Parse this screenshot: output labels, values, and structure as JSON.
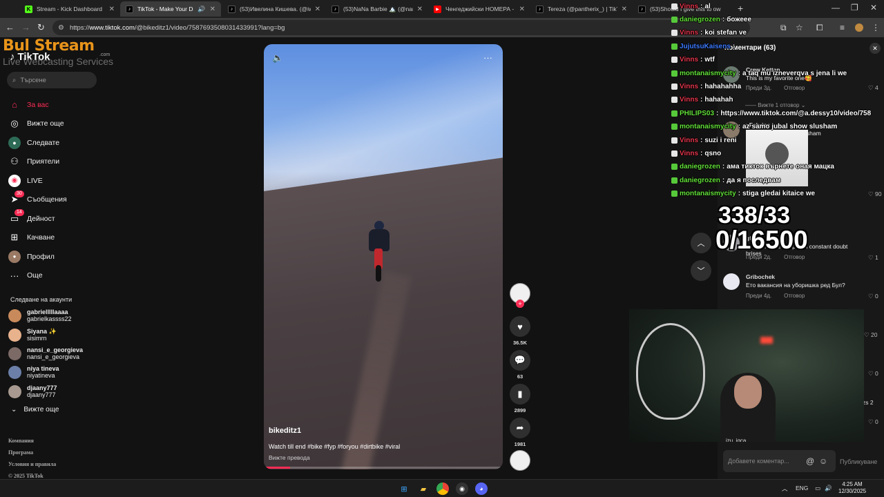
{
  "tabs": [
    {
      "title": "Stream - Kick Dashboard",
      "icon": "kick"
    },
    {
      "title": "TikTok - Make Your Day",
      "icon": "tiktok",
      "active": true
    },
    {
      "title": "(53)Ивелина Кишева. (@iwkaf",
      "icon": "tiktok"
    },
    {
      "title": "(53)NaNa Barbie 🏔️ (@nanaba",
      "icon": "tiktok"
    },
    {
      "title": "Ченгеджийски НОМЕРА - You",
      "icon": "youtube"
    },
    {
      "title": "Tereza (@pantherix_) | TikTok",
      "icon": "tiktok"
    },
    {
      "title": "(53)Should I give this to ow",
      "icon": "tiktok"
    }
  ],
  "address": {
    "scheme": "https://",
    "host": "www.tiktok.com",
    "path": "/@bikeditz1/video/7587693508031433991?lang=bg"
  },
  "tiktok": {
    "brand": "TikTok",
    "search_placeholder": "Търсене",
    "menu": [
      {
        "label": "За вас",
        "icon": "home-icon",
        "active": true
      },
      {
        "label": "Вижте още",
        "icon": "compass-icon"
      },
      {
        "label": "Следвате",
        "icon": "following-icon"
      },
      {
        "label": "Приятели",
        "icon": "friends-icon"
      },
      {
        "label": "LIVE",
        "icon": "live-icon"
      },
      {
        "label": "Съобщения",
        "icon": "messages-icon",
        "badge": "30"
      },
      {
        "label": "Дейност",
        "icon": "activity-icon",
        "badge": "14"
      },
      {
        "label": "Качване",
        "icon": "upload-icon"
      },
      {
        "label": "Профил",
        "icon": "profile-icon"
      },
      {
        "label": "Още",
        "icon": "more-icon"
      }
    ],
    "following_heading": "Следване на акаунти",
    "accounts": [
      {
        "name": "gabrielllllaaaa",
        "handle": "gabrielkassss22",
        "color": "#c98a5b"
      },
      {
        "name": "Siyana ✨",
        "handle": "sisimrn",
        "color": "#e8b28d"
      },
      {
        "name": "nansi_e_georgieva",
        "handle": "nansi_e_georgieva",
        "color": "#7c6a66"
      },
      {
        "name": "niya tineva",
        "handle": "niyatineva",
        "color": "#6b7fa8"
      },
      {
        "name": "djaany777",
        "handle": "djaany777",
        "color": "#a89a90"
      }
    ],
    "see_more": "Вижте още",
    "footer": [
      "Компания",
      "Програма",
      "Условия и правила",
      "© 2025 TikTok"
    ]
  },
  "video": {
    "author": "bikeditz1",
    "description": "Watch till end #bike #fyp #foryou #dirtbike #viral",
    "translate": "Вижте превода",
    "progress": 0.11,
    "likes": "36.5K",
    "comments": "63",
    "saves": "2899",
    "shares": "1981"
  },
  "comments_panel": {
    "heading": "Коментари (63)",
    "items": [
      {
        "name": "Crew Ketten",
        "text": "This is my favorite one🥰",
        "time": "Преди 3д.",
        "reply": "Отговор",
        "likes": "4",
        "color": "#6b7a70"
      },
      {
        "name": "xFabriss",
        "text": "az samo jubal show slusham",
        "time": "",
        "reply": "",
        "likes": "90",
        "color": "#8a7a6a"
      },
      {
        "name": "gf",
        "text": "every time i end up with constant doubt brises",
        "time": "Преди 2д.",
        "reply": "Отговор",
        "likes": "1",
        "color": "#9a9aa0"
      },
      {
        "name": "Gribochek",
        "text": "Ето вакансия на уборишка ред Бул?",
        "time": "Преди 4д.",
        "reply": "Отговор",
        "likes": "0",
        "color": "#e9e9f2"
      }
    ],
    "view_replies": "Вижте 1 отговор",
    "side_likes": [
      "20",
      "0",
      "0"
    ],
    "side_name": "zs 2",
    "bottom_name": "izu_iqca",
    "input_placeholder": "Добавете коментар...",
    "publish": "Публикуване"
  },
  "overlay": {
    "brand_line1": "Bul Stream",
    "brand_line2": "Live Webcasting Services",
    "brand_tld": ".com",
    "counter_line1": "338/33",
    "counter_line2": "0/16500"
  },
  "chat": [
    {
      "user": "Vinns",
      "color": "#e6394f",
      "msg": "al"
    },
    {
      "user": "daniegrozen",
      "color": "#63e03a",
      "msg": "божеее"
    },
    {
      "user": "Vinns",
      "color": "#e6394f",
      "msg": "koi stefan ve"
    },
    {
      "user": "JujutsuKaisens",
      "color": "#3e7bff",
      "msg": ""
    },
    {
      "user": "Vinns",
      "color": "#e6394f",
      "msg": "wtf"
    },
    {
      "user": "montanaismycity",
      "color": "#63e03a",
      "msg": "a taq mu izneverqva s jena li we"
    },
    {
      "user": "Vinns",
      "color": "#e6394f",
      "msg": "hahahahha"
    },
    {
      "user": "Vinns",
      "color": "#e6394f",
      "msg": "hahahah"
    },
    {
      "user": "PHILIPS03",
      "color": "#63e03a",
      "msg": "https://www.tiktok.com/@a.dessy10/video/758"
    },
    {
      "user": "montanaismycity",
      "color": "#63e03a",
      "msg": "az samo jubal show slusham"
    },
    {
      "user": "Vinns",
      "color": "#e6394f",
      "msg": "suzi i reni"
    },
    {
      "user": "Vinns",
      "color": "#e6394f",
      "msg": "qsno"
    },
    {
      "user": "daniegrozen",
      "color": "#63e03a",
      "msg": "ама тикток върнете оная мацка"
    },
    {
      "user": "daniegrozen",
      "color": "#63e03a",
      "msg": "да я последвам"
    },
    {
      "user": "montanaismycity",
      "color": "#63e03a",
      "msg": "stiga gledai kitaice we"
    }
  ],
  "taskbar": {
    "lang": "ENG",
    "time": "4:25 AM",
    "date": "12/30/2025"
  }
}
